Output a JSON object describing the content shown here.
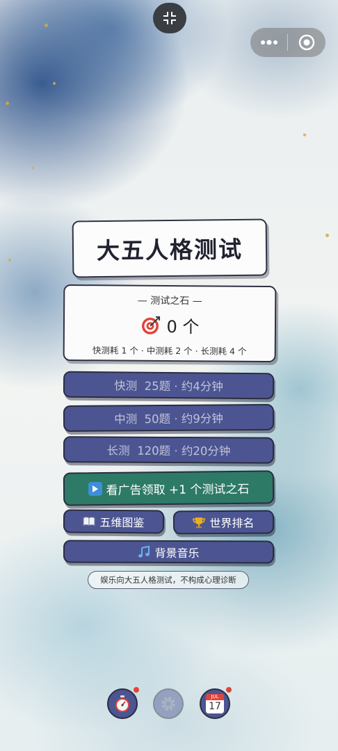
{
  "title": "大五人格测试",
  "stone": {
    "header": "— 测试之石 —",
    "count": "0 个",
    "cost": "快测耗 1 个 · 中测耗 2 个 · 长测耗 4 个",
    "icon": "target-icon"
  },
  "tests": [
    {
      "label": "快测  25题 · 约4分钟"
    },
    {
      "label": "中测  50题 · 约9分钟"
    },
    {
      "label": "长测  120题 · 约20分钟"
    }
  ],
  "ad_button": {
    "label": "看广告领取 +1 个测试之石",
    "icon": "play-icon"
  },
  "atlas_button": {
    "label": "五维图鉴",
    "icon": "book-icon"
  },
  "rank_button": {
    "label": "世界排名",
    "icon": "trophy-icon"
  },
  "music_button": {
    "label": "背景音乐",
    "icon": "music-note-icon"
  },
  "disclaimer": "娱乐向大五人格测试，不构成心理诊断",
  "bottom_icons": {
    "calendar_month": "JUL",
    "calendar_day": "17"
  },
  "colors": {
    "button_blue": "#4c5592",
    "button_green": "#2d7a66",
    "border_dark": "#2a2d40",
    "badge_red": "#e0443a"
  }
}
